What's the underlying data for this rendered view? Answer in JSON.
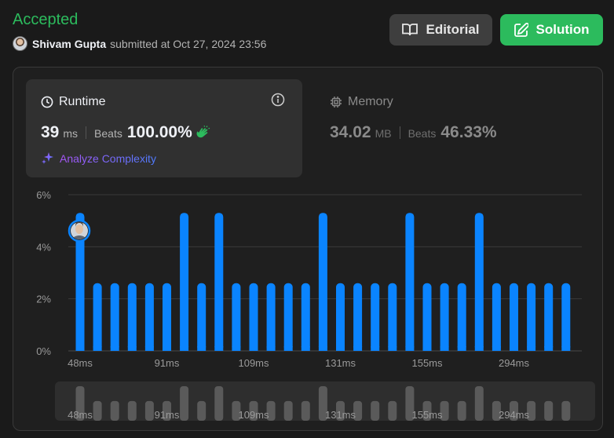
{
  "header": {
    "status": "Accepted",
    "user": "Shivam Gupta",
    "submitted_text": "submitted at Oct 27, 2024 23:56",
    "editorial_label": "Editorial",
    "solution_label": "Solution"
  },
  "runtime": {
    "title": "Runtime",
    "value": "39",
    "unit": "ms",
    "beats_label": "Beats",
    "beats_value": "100.00%",
    "analyze_label": "Analyze Complexity"
  },
  "memory": {
    "title": "Memory",
    "value": "34.02",
    "unit": "MB",
    "beats_label": "Beats",
    "beats_value": "46.33%"
  },
  "colors": {
    "accepted": "#2cbb5d",
    "bar": "#0a84ff",
    "bar_overview": "#5a5a5a"
  },
  "chart_data": {
    "type": "bar",
    "y_ticks": [
      "6%",
      "4%",
      "2%",
      "0%"
    ],
    "ylim": [
      0,
      6
    ],
    "x_tick_labels": [
      {
        "index": 0,
        "label": "48ms"
      },
      {
        "index": 5,
        "label": "91ms"
      },
      {
        "index": 10,
        "label": "109ms"
      },
      {
        "index": 15,
        "label": "131ms"
      },
      {
        "index": 20,
        "label": "155ms"
      },
      {
        "index": 25,
        "label": "294ms"
      }
    ],
    "values": [
      5.3,
      2.6,
      2.6,
      2.6,
      2.6,
      2.6,
      5.3,
      2.6,
      5.3,
      2.6,
      2.6,
      2.6,
      2.6,
      2.6,
      5.3,
      2.6,
      2.6,
      2.6,
      2.6,
      5.3,
      2.6,
      2.6,
      2.6,
      5.3,
      2.6,
      2.6,
      2.6,
      2.6,
      2.6
    ],
    "highlight_index": 0
  }
}
